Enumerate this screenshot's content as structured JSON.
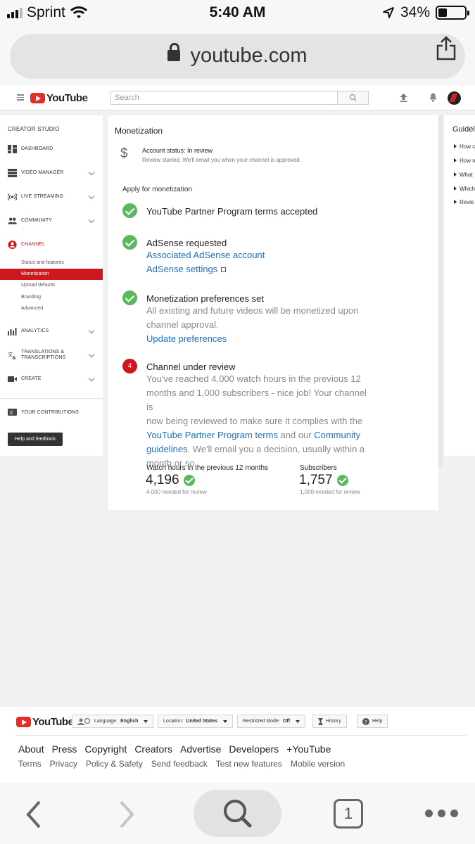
{
  "status_bar": {
    "carrier": "Sprint",
    "time": "5:40 AM",
    "battery_percent": "34%",
    "battery_level": 0.34
  },
  "browser": {
    "url": "youtube.com",
    "tab_count": "1"
  },
  "masthead": {
    "logo_text": "YouTube",
    "search_placeholder": "Search"
  },
  "sidebar": {
    "header": "CREATOR STUDIO",
    "dashboard": "DASHBOARD",
    "video_manager": "VIDEO MANAGER",
    "live_streaming": "LIVE STREAMING",
    "community": "COMMUNITY",
    "channel": "CHANNEL",
    "channel_sub": [
      "Status and features",
      "Monetization",
      "Upload defaults",
      "Branding",
      "Advanced"
    ],
    "analytics": "ANALYTICS",
    "translations_line1": "TRANSLATIONS &",
    "translations_line2": "TRANSCRIPTIONS",
    "create": "CREATE",
    "contributions": "YOUR CONTRIBUTIONS",
    "help_button": "Help and feedback"
  },
  "main": {
    "title": "Monetization",
    "account_status": "Account status: In review",
    "account_sub": "Review started. We'll email you when your channel is approved.",
    "apply_heading": "Apply for monetization",
    "step1_title": "YouTube Partner Program terms accepted",
    "step2_title": "AdSense requested",
    "step2_link1": "Associated AdSense account",
    "step2_link2": "AdSense settings",
    "step3_title": "Monetization preferences set",
    "step3_text_l1": "All existing and future videos will be monetized upon",
    "step3_text_l2": "channel approval.",
    "step3_link": "Update preferences",
    "step4_number": "4",
    "step4_title": "Channel under review",
    "step4_l1": "You've reached 4,000 watch hours in the previous 12",
    "step4_l2": "months and 1,000 subscribers - nice job! Your channel is",
    "step4_l3": "now being reviewed to make sure it complies with the",
    "step4_link1": "YouTube Partner Program terms",
    "step4_mid": " and our ",
    "step4_link2a": "Community",
    "step4_link2b": "guidelines",
    "step4_l5_rest": ". We'll email you a decision, usually within a",
    "step4_l6": "month or so.",
    "watch_label": "Watch hours in the previous 12 months",
    "watch_value": "4,196",
    "watch_sub": "4,000 needed for review",
    "subs_label": "Subscribers",
    "subs_value": "1,757",
    "subs_sub": "1,000 needed for review"
  },
  "guidelines": {
    "title": "Guidel",
    "items": [
      "How c",
      "How m",
      "What",
      "Which",
      "Revie"
    ]
  },
  "footer": {
    "logo_text": "YouTube",
    "language_label": "Language:",
    "language_value": "English",
    "location_label": "Location:",
    "location_value": "United States",
    "restricted_label": "Restricted Mode:",
    "restricted_value": "Off",
    "history": "History",
    "help": "Help",
    "links_row1": [
      "About",
      "Press",
      "Copyright",
      "Creators",
      "Advertise",
      "Developers",
      "+YouTube"
    ],
    "links_row2": [
      "Terms",
      "Privacy",
      "Policy & Safety",
      "Send feedback",
      "Test new features",
      "Mobile version"
    ]
  }
}
